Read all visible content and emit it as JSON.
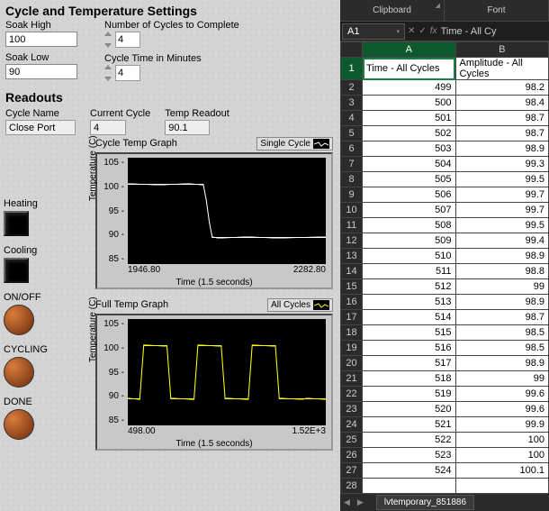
{
  "labview": {
    "settings_title": "Cycle and Temperature Settings",
    "soak_high_label": "Soak High",
    "soak_high_value": "100",
    "soak_low_label": "Soak Low",
    "soak_low_value": "90",
    "num_cycles_label": "Number of Cycles to Complete",
    "num_cycles_value": "4",
    "cycle_time_label": "Cycle Time in Minutes",
    "cycle_time_value": "4",
    "readouts_title": "Readouts",
    "cycle_name_label": "Cycle Name",
    "cycle_name_value": "Close Port",
    "current_cycle_label": "Current Cycle",
    "current_cycle_value": "4",
    "temp_readout_label": "Temp Readout",
    "temp_readout_value": "90.1",
    "chart1_title": "Cycle Temp Graph",
    "chart1_legend": "Single Cycle",
    "chart2_title": "Full Temp Graph",
    "chart2_legend": "All Cycles",
    "xlabel": "Time (1.5 seconds)",
    "ylabel": "Temperature (C)",
    "heating_label": "Heating",
    "cooling_label": "Cooling",
    "onoff_label": "ON/OFF",
    "cycling_label": "CYCLING",
    "done_label": "DONE"
  },
  "excel": {
    "ribbon_groups": [
      "Clipboard",
      "Font"
    ],
    "namebox": "A1",
    "formula": "Time - All Cy",
    "cols": [
      "A",
      "B"
    ],
    "headers": [
      "Time - All Cycles",
      "Amplitude - All Cycles"
    ],
    "rows": [
      {
        "n": 1,
        "a": "Time - All Cycles",
        "b": "Amplitude - All Cycles",
        "hdr": true
      },
      {
        "n": 2,
        "a": "499",
        "b": "98.2"
      },
      {
        "n": 3,
        "a": "500",
        "b": "98.4"
      },
      {
        "n": 4,
        "a": "501",
        "b": "98.7"
      },
      {
        "n": 5,
        "a": "502",
        "b": "98.7"
      },
      {
        "n": 6,
        "a": "503",
        "b": "98.9"
      },
      {
        "n": 7,
        "a": "504",
        "b": "99.3"
      },
      {
        "n": 8,
        "a": "505",
        "b": "99.5"
      },
      {
        "n": 9,
        "a": "506",
        "b": "99.7"
      },
      {
        "n": 10,
        "a": "507",
        "b": "99.7"
      },
      {
        "n": 11,
        "a": "508",
        "b": "99.5"
      },
      {
        "n": 12,
        "a": "509",
        "b": "99.4"
      },
      {
        "n": 13,
        "a": "510",
        "b": "98.9"
      },
      {
        "n": 14,
        "a": "511",
        "b": "98.8"
      },
      {
        "n": 15,
        "a": "512",
        "b": "99"
      },
      {
        "n": 16,
        "a": "513",
        "b": "98.9"
      },
      {
        "n": 17,
        "a": "514",
        "b": "98.7"
      },
      {
        "n": 18,
        "a": "515",
        "b": "98.5"
      },
      {
        "n": 19,
        "a": "516",
        "b": "98.5"
      },
      {
        "n": 20,
        "a": "517",
        "b": "98.9"
      },
      {
        "n": 21,
        "a": "518",
        "b": "99"
      },
      {
        "n": 22,
        "a": "519",
        "b": "99.6"
      },
      {
        "n": 23,
        "a": "520",
        "b": "99.6"
      },
      {
        "n": 24,
        "a": "521",
        "b": "99.9"
      },
      {
        "n": 25,
        "a": "522",
        "b": "100"
      },
      {
        "n": 26,
        "a": "523",
        "b": "100"
      },
      {
        "n": 27,
        "a": "524",
        "b": "100.1"
      },
      {
        "n": 28,
        "a": "",
        "b": ""
      }
    ],
    "sheet_tab": "lvtemporary_851886",
    "selected_cell": "A1"
  },
  "chart_data": [
    {
      "type": "line",
      "title": "Cycle Temp Graph",
      "legend": "Single Cycle",
      "color": "#ffffff",
      "xlabel": "Time (1.5 seconds)",
      "ylabel": "Temperature (C)",
      "ylim": [
        85,
        105
      ],
      "xlim": [
        1946.8,
        2282.8
      ],
      "yticks": [
        85,
        90,
        95,
        100,
        105
      ],
      "xticks": [
        1946.8,
        2282.8
      ],
      "x": [
        1946.8,
        2000,
        2050,
        2075,
        2080,
        2085,
        2090,
        2100,
        2150,
        2200,
        2282.8
      ],
      "values": [
        100,
        100,
        100,
        100,
        97,
        93,
        90,
        90,
        90,
        90,
        90
      ]
    },
    {
      "type": "line",
      "title": "Full Temp Graph",
      "legend": "All Cycles",
      "color": "#ffff00",
      "xlabel": "Time (1.5 seconds)",
      "ylabel": "Temperature (C)",
      "ylim": [
        85,
        105
      ],
      "xlim": [
        498.0,
        1520
      ],
      "yticks": [
        85,
        90,
        95,
        100,
        105
      ],
      "xticks": [
        498.0,
        "1.52E+3"
      ],
      "x": [
        498,
        560,
        580,
        700,
        720,
        840,
        860,
        980,
        1000,
        1120,
        1140,
        1260,
        1280,
        1400,
        1420,
        1520
      ],
      "values": [
        90,
        90,
        100,
        100,
        90,
        90,
        100,
        100,
        90,
        90,
        100,
        100,
        90,
        90,
        90,
        90
      ]
    }
  ]
}
